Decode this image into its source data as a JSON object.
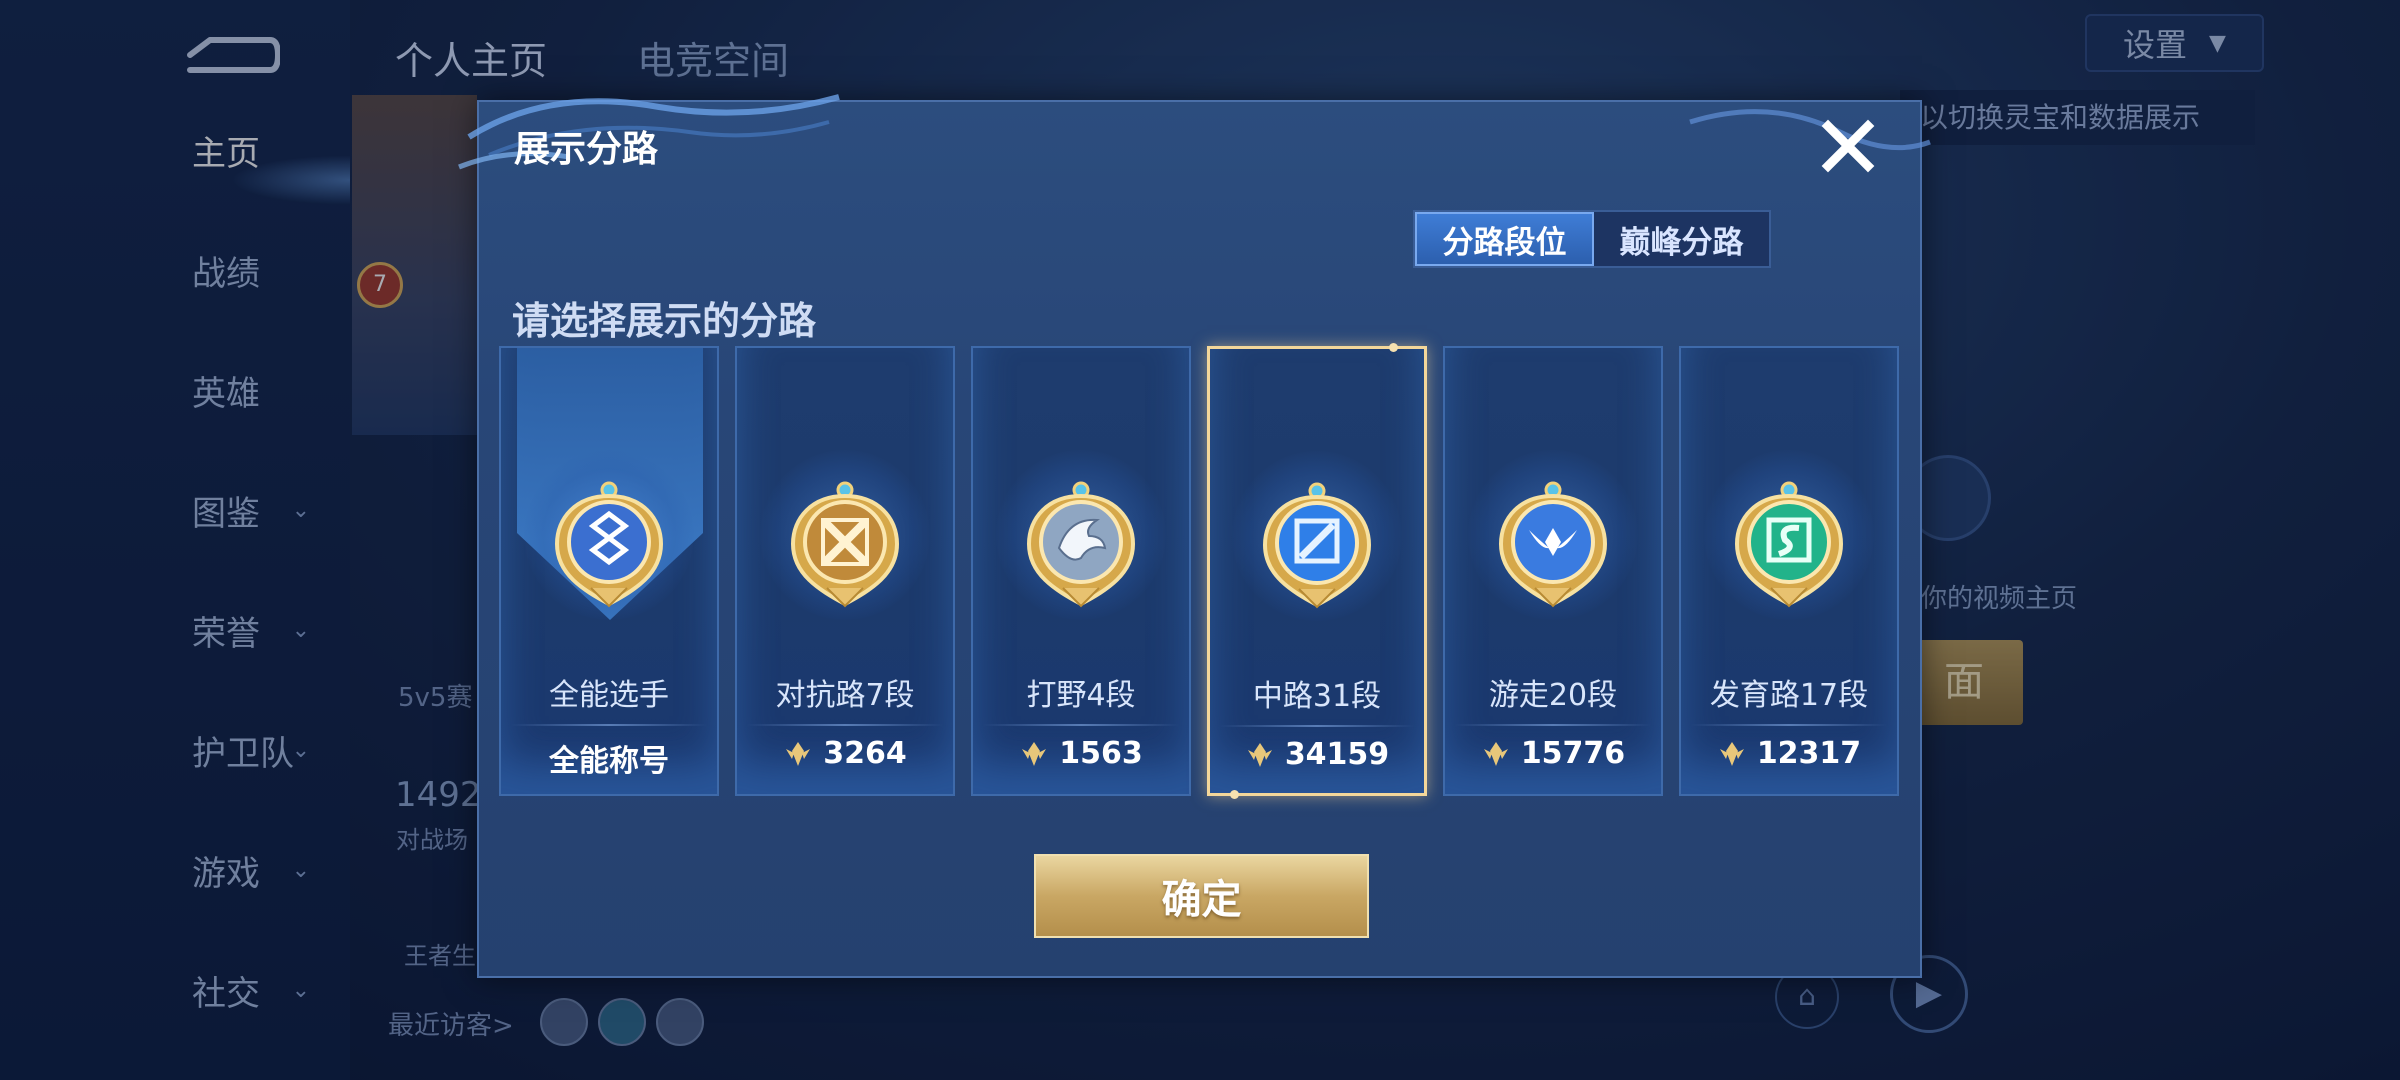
{
  "sidebar": {
    "items": [
      {
        "label": "主页",
        "has_chevron": false,
        "active": true
      },
      {
        "label": "战绩",
        "has_chevron": false,
        "active": false
      },
      {
        "label": "英雄",
        "has_chevron": false,
        "active": false
      },
      {
        "label": "图鉴",
        "has_chevron": true,
        "active": false
      },
      {
        "label": "荣誉",
        "has_chevron": true,
        "active": false
      },
      {
        "label": "护卫队",
        "has_chevron": true,
        "active": false
      },
      {
        "label": "游戏",
        "has_chevron": true,
        "active": false
      },
      {
        "label": "社交",
        "has_chevron": true,
        "active": false
      }
    ]
  },
  "header": {
    "tabs": [
      {
        "label": "个人主页"
      },
      {
        "label": "电竞空间"
      }
    ],
    "settings_label": "设置",
    "hint": "以切换灵宝和数据展示"
  },
  "background": {
    "level_badge": "7",
    "mode_label": "5v5赛",
    "score": "1492",
    "score_sub": "对战场",
    "wz_label": "王者生",
    "visitors_label": "最近访客>",
    "video_text": "创你的视频主页",
    "gold_button": "面"
  },
  "modal": {
    "title": "展示分路",
    "toggle": {
      "options": [
        "分路段位",
        "巅峰分路"
      ],
      "selected": 0
    },
    "section_title": "请选择展示的分路",
    "cards": [
      {
        "name": "全能选手",
        "value": "全能称号",
        "has_score_icon": false,
        "selected": false,
        "badge": "all-round-badge-icon",
        "badge_color": "#3b6fd0"
      },
      {
        "name": "对抗路7段",
        "value": "3264",
        "has_score_icon": true,
        "selected": false,
        "badge": "clash-lane-badge-icon",
        "badge_color": "#c08a3a"
      },
      {
        "name": "打野4段",
        "value": "1563",
        "has_score_icon": true,
        "selected": false,
        "badge": "jungle-badge-icon",
        "badge_color": "#8fa6c2"
      },
      {
        "name": "中路31段",
        "value": "34159",
        "has_score_icon": true,
        "selected": true,
        "badge": "mid-lane-badge-icon",
        "badge_color": "#2f7fe8"
      },
      {
        "name": "游走20段",
        "value": "15776",
        "has_score_icon": true,
        "selected": false,
        "badge": "roam-badge-icon",
        "badge_color": "#3a7be0"
      },
      {
        "name": "发育路17段",
        "value": "12317",
        "has_score_icon": true,
        "selected": false,
        "badge": "farm-lane-badge-icon",
        "badge_color": "#22b38a"
      }
    ],
    "confirm_label": "确定"
  }
}
